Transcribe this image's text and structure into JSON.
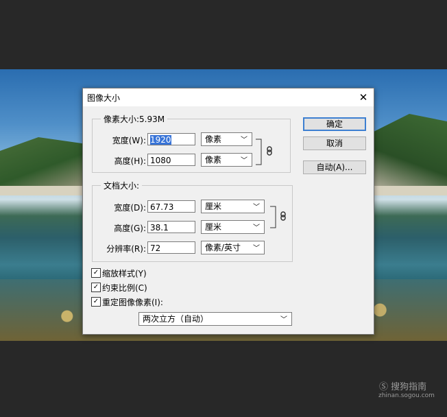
{
  "dialog": {
    "title": "图像大小",
    "close_icon": "close-icon"
  },
  "pixel_dimensions": {
    "legend": "像素大小:5.93M",
    "width_label": "宽度(W):",
    "width_value": "1920",
    "width_unit": "像素",
    "height_label": "高度(H):",
    "height_value": "1080",
    "height_unit": "像素"
  },
  "document_size": {
    "legend": "文档大小:",
    "width_label": "宽度(D):",
    "width_value": "67.73",
    "width_unit": "厘米",
    "height_label": "高度(G):",
    "height_value": "38.1",
    "height_unit": "厘米",
    "resolution_label": "分辨率(R):",
    "resolution_value": "72",
    "resolution_unit": "像素/英寸"
  },
  "buttons": {
    "ok": "确定",
    "cancel": "取消",
    "auto": "自动(A)..."
  },
  "options": {
    "scale_styles": "缩放样式(Y)",
    "constrain": "约束比例(C)",
    "resample": "重定图像像素(I):",
    "resample_method": "两次立方（自动）",
    "scale_styles_checked": true,
    "constrain_checked": true,
    "resample_checked": true
  },
  "watermark": {
    "brand": "搜狗指南",
    "url": "zhinan.sogou.com"
  }
}
